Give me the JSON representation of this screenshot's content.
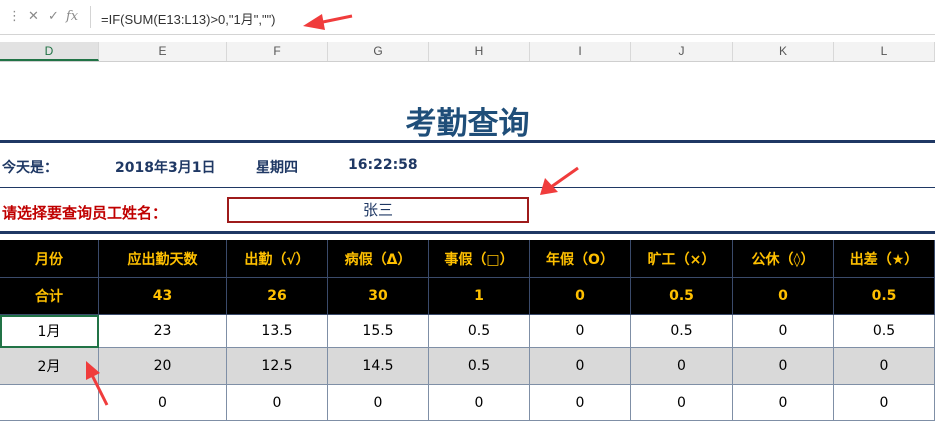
{
  "formula_bar": {
    "cancel_icon": "✕",
    "confirm_icon": "✓",
    "fx_label": "fx",
    "formula": "=IF(SUM(E13:L13)>0,\"1月\",\"\")"
  },
  "columns": [
    "D",
    "E",
    "F",
    "G",
    "H",
    "I",
    "J",
    "K",
    "L"
  ],
  "title": "考勤查询",
  "info": {
    "today_label": "今天是：",
    "date": "2018年3月1日",
    "weekday": "星期四",
    "time": "16:22:58"
  },
  "query": {
    "prompt": "请选择要查询员工姓名：",
    "name": "张三"
  },
  "table": {
    "headers": [
      "月份",
      "应出勤天数",
      "出勤（√）",
      "病假（Δ）",
      "事假（□）",
      "年假（O）",
      "旷工（×）",
      "公休（◊）",
      "出差（★）"
    ],
    "totals": [
      "合计",
      "43",
      "26",
      "30",
      "1",
      "0",
      "0.5",
      "0",
      "0.5"
    ],
    "rows": [
      [
        "1月",
        "23",
        "13.5",
        "15.5",
        "0.5",
        "0",
        "0.5",
        "0",
        "0.5"
      ],
      [
        "2月",
        "20",
        "12.5",
        "14.5",
        "0.5",
        "0",
        "0",
        "0",
        "0"
      ],
      [
        "",
        "0",
        "0",
        "0",
        "0",
        "0",
        "0",
        "0",
        "0"
      ]
    ]
  },
  "colors": {
    "title": "#1f4e79",
    "header_bg": "#000000",
    "header_text": "#ffc000",
    "alt_row": "#d9d9d9",
    "prompt": "#c00000",
    "excel_green": "#217346",
    "arrow": "#f03c3c"
  }
}
